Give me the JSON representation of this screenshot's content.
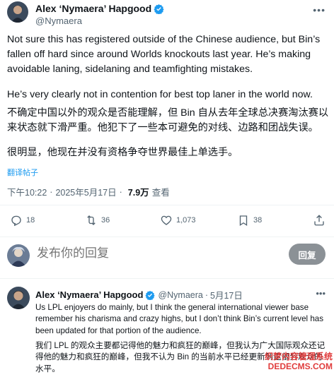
{
  "post": {
    "author_name": "Alex ‘Nymaera’ Hapgood",
    "author_handle": "@Nymaera",
    "paragraphs": [
      "Not sure this has registered outside of the Chinese audience, but Bin’s fallen off hard since around Worlds knockouts last year. He’s making avoidable laning, sidelaning and teamfighting mistakes.",
      "He’s very clearly not in contention for best top laner in the world now.",
      "不确定中国以外的观众是否能理解，但 Bin 自从去年全球总决赛淘汰赛以来状态就下滑严重。他犯下了一些本可避免的对线、边路和团战失误。",
      "很明显，他现在并没有资格争夺世界最佳上单选手。"
    ],
    "translate_label": "翻译帖子",
    "time": "下午10:22",
    "date": "2025年5月17日",
    "views_count": "7.9万",
    "views_label": "查看"
  },
  "actions": {
    "replies": "18",
    "reposts": "36",
    "likes": "1,073",
    "bookmarks": "38"
  },
  "compose": {
    "placeholder": "发布你的回复",
    "button_label": "回复"
  },
  "reply": {
    "author_name": "Alex ‘Nymaera’ Hapgood",
    "author_handle": "@Nymaera",
    "date": "5月17日",
    "text_en": "Us LPL enjoyers do mainly, but I think the general international viewer base remember his charisma and crazy highs, but I don’t think Bin’s current level has been updated for that portion of the audience.",
    "text_zh": "我们 LPL 的观众主要都记得他的魅力和疯狂的巅峰，但我认为广大国际观众还记得他的魅力和疯狂的巅峰，但我不认为 Bin 的当前水平已经更新到这部分观众的水平。"
  },
  "watermark": {
    "line1": "织梦内容管理系统",
    "line2": "DEDECMS.COM"
  },
  "colors": {
    "accent": "#1d9bf0",
    "muted": "#536471",
    "reply_button": "#8b9196"
  }
}
